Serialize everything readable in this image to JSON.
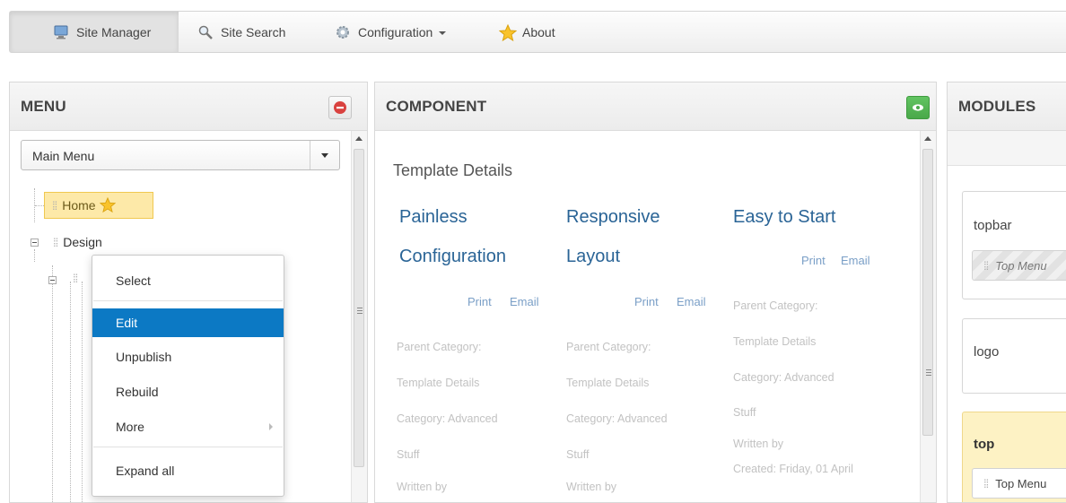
{
  "navbar": {
    "items": [
      {
        "label": "Site Manager",
        "icon": "monitor-icon",
        "active": true
      },
      {
        "label": "Site Search",
        "icon": "magnifier-icon",
        "active": false
      },
      {
        "label": "Configuration",
        "icon": "gear-icon",
        "active": false,
        "dropdown": true
      },
      {
        "label": "About",
        "icon": "star-icon",
        "active": false
      }
    ]
  },
  "menu_panel": {
    "title": "MENU",
    "select_value": "Main Menu",
    "tree": {
      "home": "Home",
      "design": "Design"
    },
    "context_menu": [
      {
        "label": "Select"
      },
      {
        "label": "Edit",
        "selected": true
      },
      {
        "label": "Unpublish"
      },
      {
        "label": "Rebuild"
      },
      {
        "label": "More",
        "submenu": true
      },
      {
        "label": "Expand all"
      }
    ]
  },
  "component_panel": {
    "title": "COMPONENT",
    "heading": "Template Details",
    "columns": [
      {
        "title_line1": "Painless",
        "title_line2": "Configuration",
        "print": "Print",
        "email": "Email",
        "meta": [
          "Parent Category:",
          "Template Details",
          "Category: Advanced",
          "Stuff",
          "Written by"
        ]
      },
      {
        "title_line1": "Responsive",
        "title_line2": "Layout",
        "print": "Print",
        "email": "Email",
        "meta": [
          "Parent Category:",
          "Template Details",
          "Category: Advanced",
          "Stuff",
          "Written by"
        ]
      },
      {
        "title_line1": "Easy to Start",
        "print": "Print",
        "email": "Email",
        "meta": [
          "Parent Category:",
          "Template Details",
          "Category: Advanced",
          "Stuff",
          "Written by",
          "Created: Friday, 01 April"
        ]
      }
    ]
  },
  "modules_panel": {
    "title": "MODULES",
    "positions": [
      {
        "name": "topbar",
        "module": "Top Menu"
      },
      {
        "name": "logo"
      },
      {
        "name": "top",
        "module": "Top Menu"
      }
    ]
  },
  "colors": {
    "selected_blue": "#0c79c4",
    "home_highlight": "#fde9a8",
    "link_blue": "#2a6496",
    "remove_red": "#d9423f",
    "preview_green": "#5cb85c"
  }
}
